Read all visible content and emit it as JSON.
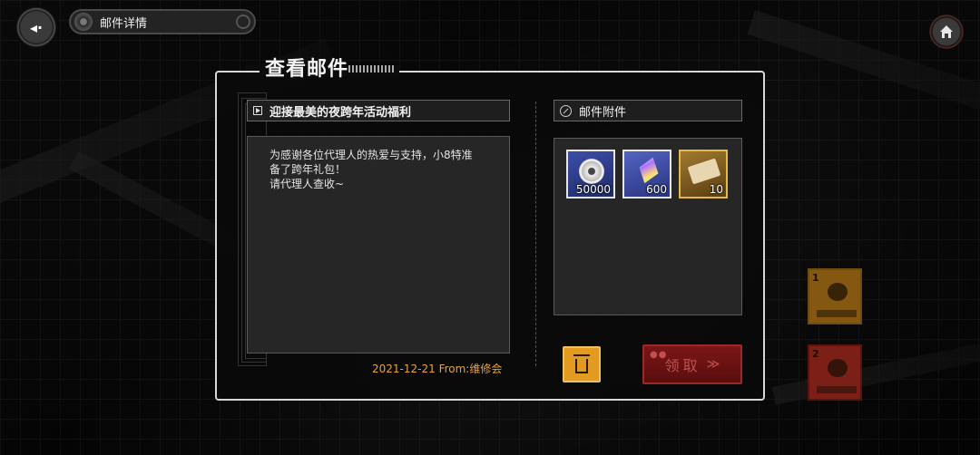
{
  "header": {
    "back_icon": "back-arrow-icon",
    "title": "邮件详情",
    "home_icon": "home-icon"
  },
  "panel": {
    "title": "查看邮件"
  },
  "mail": {
    "subject": "迎接最美的夜跨年活动福利",
    "body": "为感谢各位代理人的热爱与支持，小8特准\n备了跨年礼包！\n请代理人查收~",
    "date": "2021-12-21",
    "from": "From:维修会"
  },
  "attachments": {
    "header": "邮件附件",
    "items": [
      {
        "name": "disc",
        "qty": "50000",
        "icon": "disc-icon"
      },
      {
        "name": "crystal",
        "qty": "600",
        "icon": "crystal-icon"
      },
      {
        "name": "ticket",
        "qty": "10",
        "icon": "ticket-icon"
      }
    ]
  },
  "actions": {
    "delete_icon": "trash-icon",
    "claim_label": "领取",
    "claim_icon": "double-chevron-down-icon"
  },
  "side_cards": [
    {
      "num": "1",
      "color": "#f0a020"
    },
    {
      "num": "2",
      "color": "#e23a2a"
    }
  ],
  "colors": {
    "accent_orange": "#e39a20",
    "date_orange": "#e8a43a",
    "claim_red": "#7a1616"
  }
}
